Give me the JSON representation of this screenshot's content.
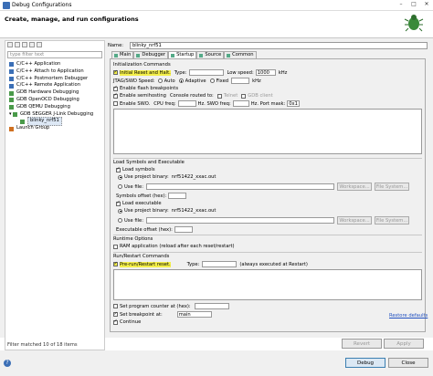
{
  "window": {
    "title": "Debug Configurations"
  },
  "header": {
    "title": "Create, manage, and run configurations"
  },
  "left": {
    "filter_placeholder": "type filter text",
    "tree": [
      {
        "label": "C/C++ Application",
        "level": 0
      },
      {
        "label": "C/C++ Attach to Application",
        "level": 0
      },
      {
        "label": "C/C++ Postmortem Debugger",
        "level": 0
      },
      {
        "label": "C/C++ Remote Application",
        "level": 0
      },
      {
        "label": "GDB Hardware Debugging",
        "level": 0
      },
      {
        "label": "GDB OpenOCD Debugging",
        "level": 0
      },
      {
        "label": "GDB QEMU Debugging",
        "level": 0
      },
      {
        "label": "GDB SEGGER J-Link Debugging",
        "level": 0
      },
      {
        "label": "blinky_nrf51",
        "level": 1
      },
      {
        "label": "Launch Group",
        "level": 0
      }
    ],
    "status": "Filter matched 10 of 18 items"
  },
  "config": {
    "name_label": "Name:",
    "name_value": "blinky_nrf51",
    "tabs": [
      "Main",
      "Debugger",
      "Startup",
      "Source",
      "Common"
    ],
    "active_tab": "Startup"
  },
  "init": {
    "heading": "Initialization Commands",
    "initial_reset": "Initial Reset and Halt.",
    "type_label": "Type:",
    "low_speed_label": "Low speed:",
    "low_speed_value": "1000",
    "khz": "kHz",
    "jtag_label": "JTAG/SWD Speed:",
    "auto": "Auto",
    "adaptive": "Adaptive",
    "fixed": "Fixed",
    "fixed_khz": "kHz",
    "flash_bp": "Enable flash breakpoints",
    "semihosting": "Enable semihosting",
    "console_routed": "Console routed to:",
    "telnet": "Telnet",
    "gdb_client": "GDB client",
    "swo": "Enable SWO.",
    "cpu_freq": "CPU freq:",
    "swo_hz1": "Hz. SWO freq:",
    "swo_hz2": "Hz. Port mask:",
    "port_mask": "0x1"
  },
  "load": {
    "heading": "Load Symbols and Executable",
    "load_symbols": "Load symbols",
    "use_project_binary": "Use project binary:",
    "binary": "nrf51422_xxac.out",
    "use_file": "Use file:",
    "workspace": "Workspace...",
    "file_system": "File System...",
    "symbols_offset": "Symbols offset (hex):",
    "load_executable": "Load executable",
    "use_project_binary2": "Use project binary:",
    "binary2": "nrf51422_xxac.out",
    "use_file2": "Use file:",
    "workspace2": "Workspace...",
    "file_system2": "File System...",
    "exec_offset": "Executable offset (hex):"
  },
  "runtime": {
    "heading": "Runtime Options",
    "ram_app": "RAM application (reload after each reset/restart)"
  },
  "restart": {
    "heading": "Run/Restart Commands",
    "pre_run": "Pre-run/Restart reset.",
    "type_label": "Type:",
    "always_exec": "(always executed at Restart)",
    "set_pc": "Set program counter at (hex):",
    "set_bp": "Set breakpoint at:",
    "bp_value": "main",
    "continue": "Continue"
  },
  "actions": {
    "restore": "Restore defaults",
    "revert": "Revert",
    "apply": "Apply",
    "debug": "Debug",
    "close": "Close"
  },
  "colors": {
    "highlight": "#f4ef4a",
    "link": "#2050c0"
  }
}
